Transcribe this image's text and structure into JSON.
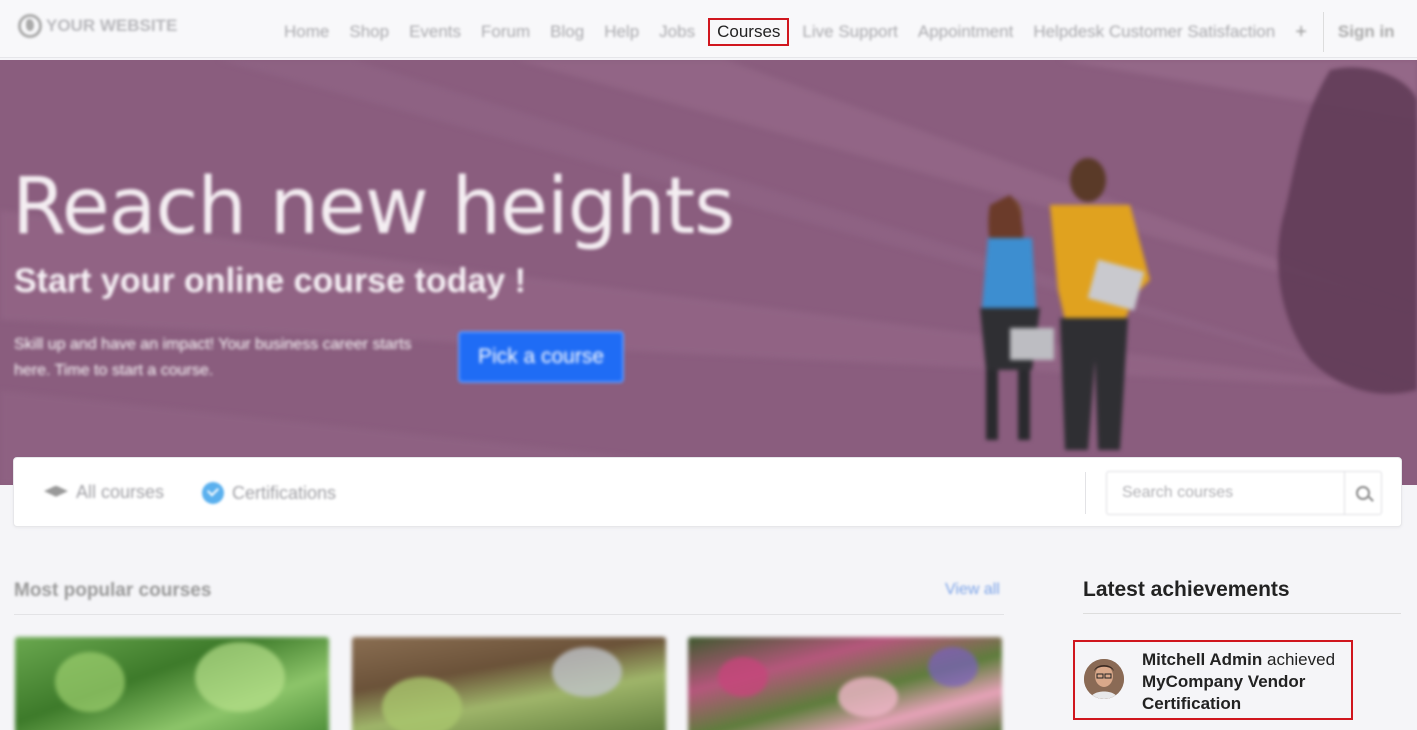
{
  "header": {
    "logo_text": "YOUR WEBSITE",
    "nav": [
      {
        "id": "home",
        "label": "Home"
      },
      {
        "id": "shop",
        "label": "Shop"
      },
      {
        "id": "events",
        "label": "Events"
      },
      {
        "id": "forum",
        "label": "Forum"
      },
      {
        "id": "blog",
        "label": "Blog"
      },
      {
        "id": "help",
        "label": "Help"
      },
      {
        "id": "jobs",
        "label": "Jobs"
      },
      {
        "id": "courses",
        "label": "Courses"
      },
      {
        "id": "live-support",
        "label": "Live Support"
      },
      {
        "id": "appointment",
        "label": "Appointment"
      },
      {
        "id": "helpdesk",
        "label": "Helpdesk Customer Satisfaction"
      }
    ],
    "plus_icon": "+",
    "sign_in_label": "Sign in"
  },
  "hero": {
    "title": "Reach new heights",
    "subtitle": "Start your online course today !",
    "text": "Skill up and have an impact! Your business career starts here. Time to start a course.",
    "button_label": "Pick a course",
    "colors": {
      "background": "#8a5d7e",
      "button": "#1f6cf5"
    }
  },
  "tabs": {
    "all_courses": "All courses",
    "certifications": "Certifications",
    "search_placeholder": "Search courses",
    "icons": [
      "graduation-cap-icon",
      "check-badge-icon",
      "search-icon"
    ]
  },
  "popular": {
    "title": "Most popular courses",
    "view_all": "View all"
  },
  "achievements": {
    "title": "Latest achievements",
    "items": [
      {
        "user": "Mitchell Admin",
        "verb": "achieved",
        "certification": "MyCompany Vendor Certification"
      }
    ]
  },
  "colors": {
    "highlight": "#d0161e"
  }
}
